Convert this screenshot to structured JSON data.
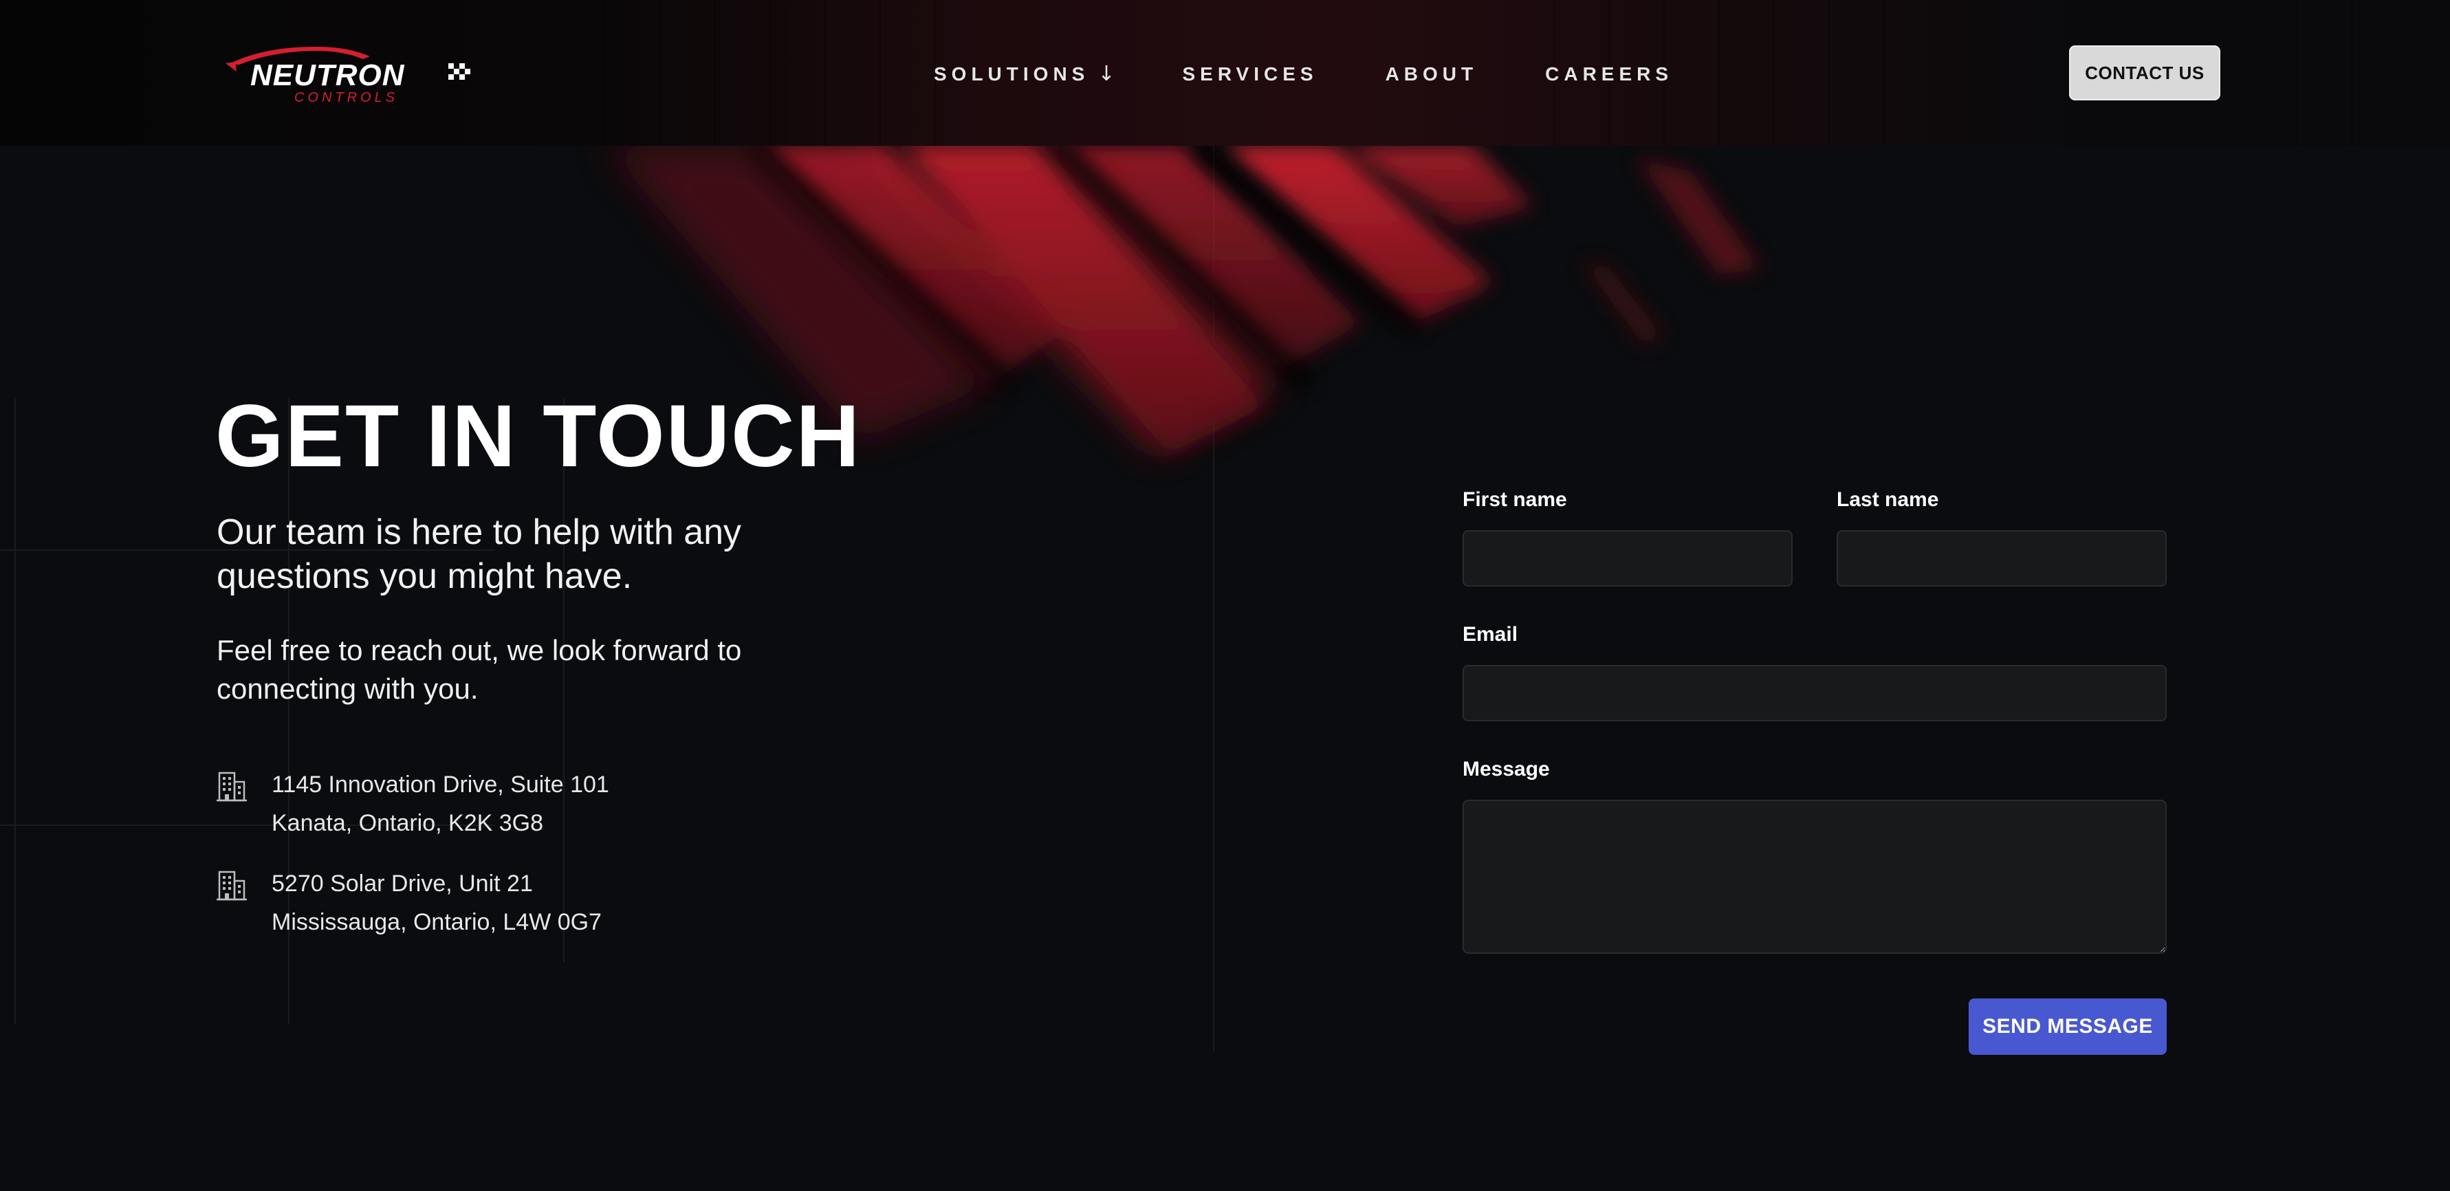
{
  "brand": {
    "logo_text": "NEUTRON",
    "logo_subtext": "CONTROLS",
    "accent_color": "#d51f2f"
  },
  "nav": {
    "items": [
      {
        "label": "SOLUTIONS",
        "icon": "arrow-down-icon",
        "icon_glyph": "↓"
      },
      {
        "label": "SERVICES"
      },
      {
        "label": "ABOUT"
      },
      {
        "label": "CAREERS"
      }
    ],
    "contact_label": "CONTACT US"
  },
  "hero": {
    "title": "GET IN TOUCH",
    "subtitle": "Our team is here to help with any questions you might have.",
    "intro": "Feel free to reach out, we look forward to connecting with you."
  },
  "addresses": [
    {
      "icon": "building-icon",
      "line1": "1145 Innovation Drive, Suite 101",
      "line2": "Kanata, Ontario, K2K 3G8"
    },
    {
      "icon": "building-icon",
      "line1": "5270 Solar Drive, Unit 21",
      "line2": "Mississauga, Ontario, L4W 0G7"
    }
  ],
  "form": {
    "first_name_label": "First name",
    "first_name_value": "",
    "last_name_label": "Last name",
    "last_name_value": "",
    "email_label": "Email",
    "email_value": "",
    "message_label": "Message",
    "message_value": "",
    "submit_label": "SEND MESSAGE",
    "submit_color": "#4858d0"
  }
}
